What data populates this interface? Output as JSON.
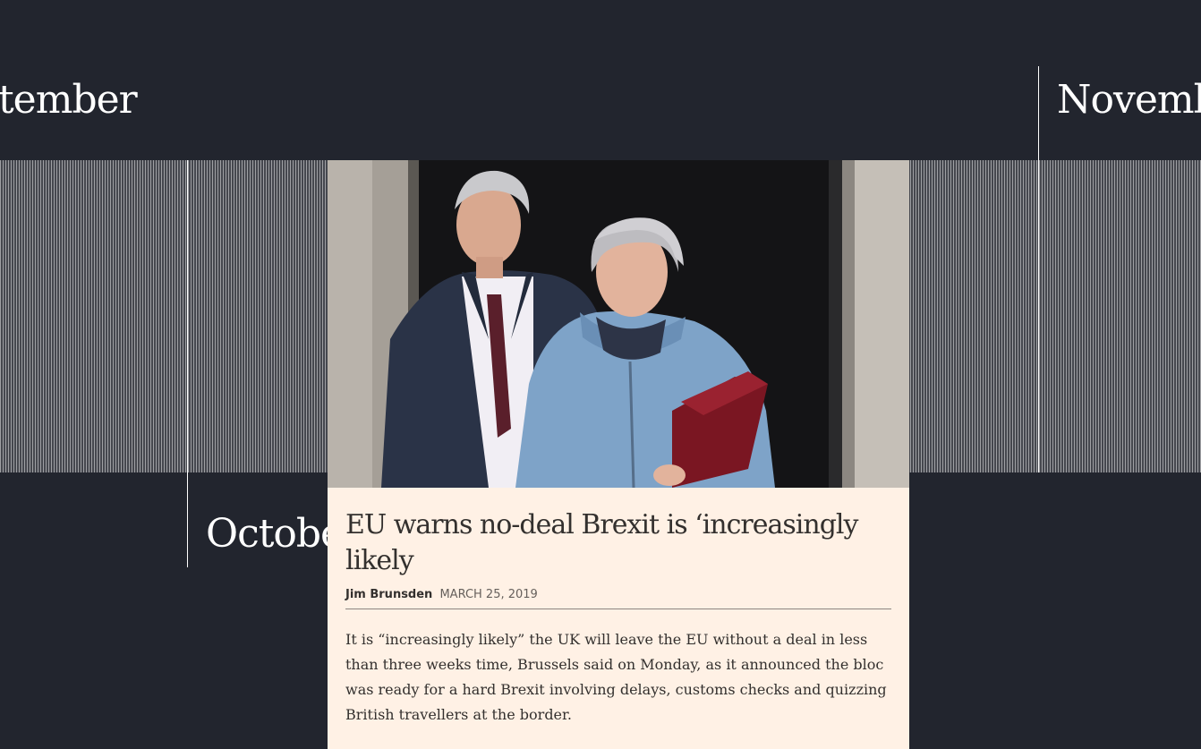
{
  "timeline": {
    "months": {
      "september": "tember",
      "october": "October",
      "november": "November"
    }
  },
  "article": {
    "image_alt": "Theresa May and Stephen Barclay leaving 10 Downing Street",
    "headline": "EU warns no-deal Brexit is ‘increasingly likely",
    "author": "Jim Brunsden",
    "date": "MARCH 25, 2019",
    "summary": "It is “increasingly likely” the UK will leave the EU without a deal in less than three weeks time, Brussels said on Monday, as it announced the bloc was ready for a hard Brexit involving delays, customs checks and quizzing British travellers at the border."
  },
  "colors": {
    "background": "#22252e",
    "card": "#fff1e5",
    "text": "#33302e",
    "band": "#5a5c63"
  }
}
